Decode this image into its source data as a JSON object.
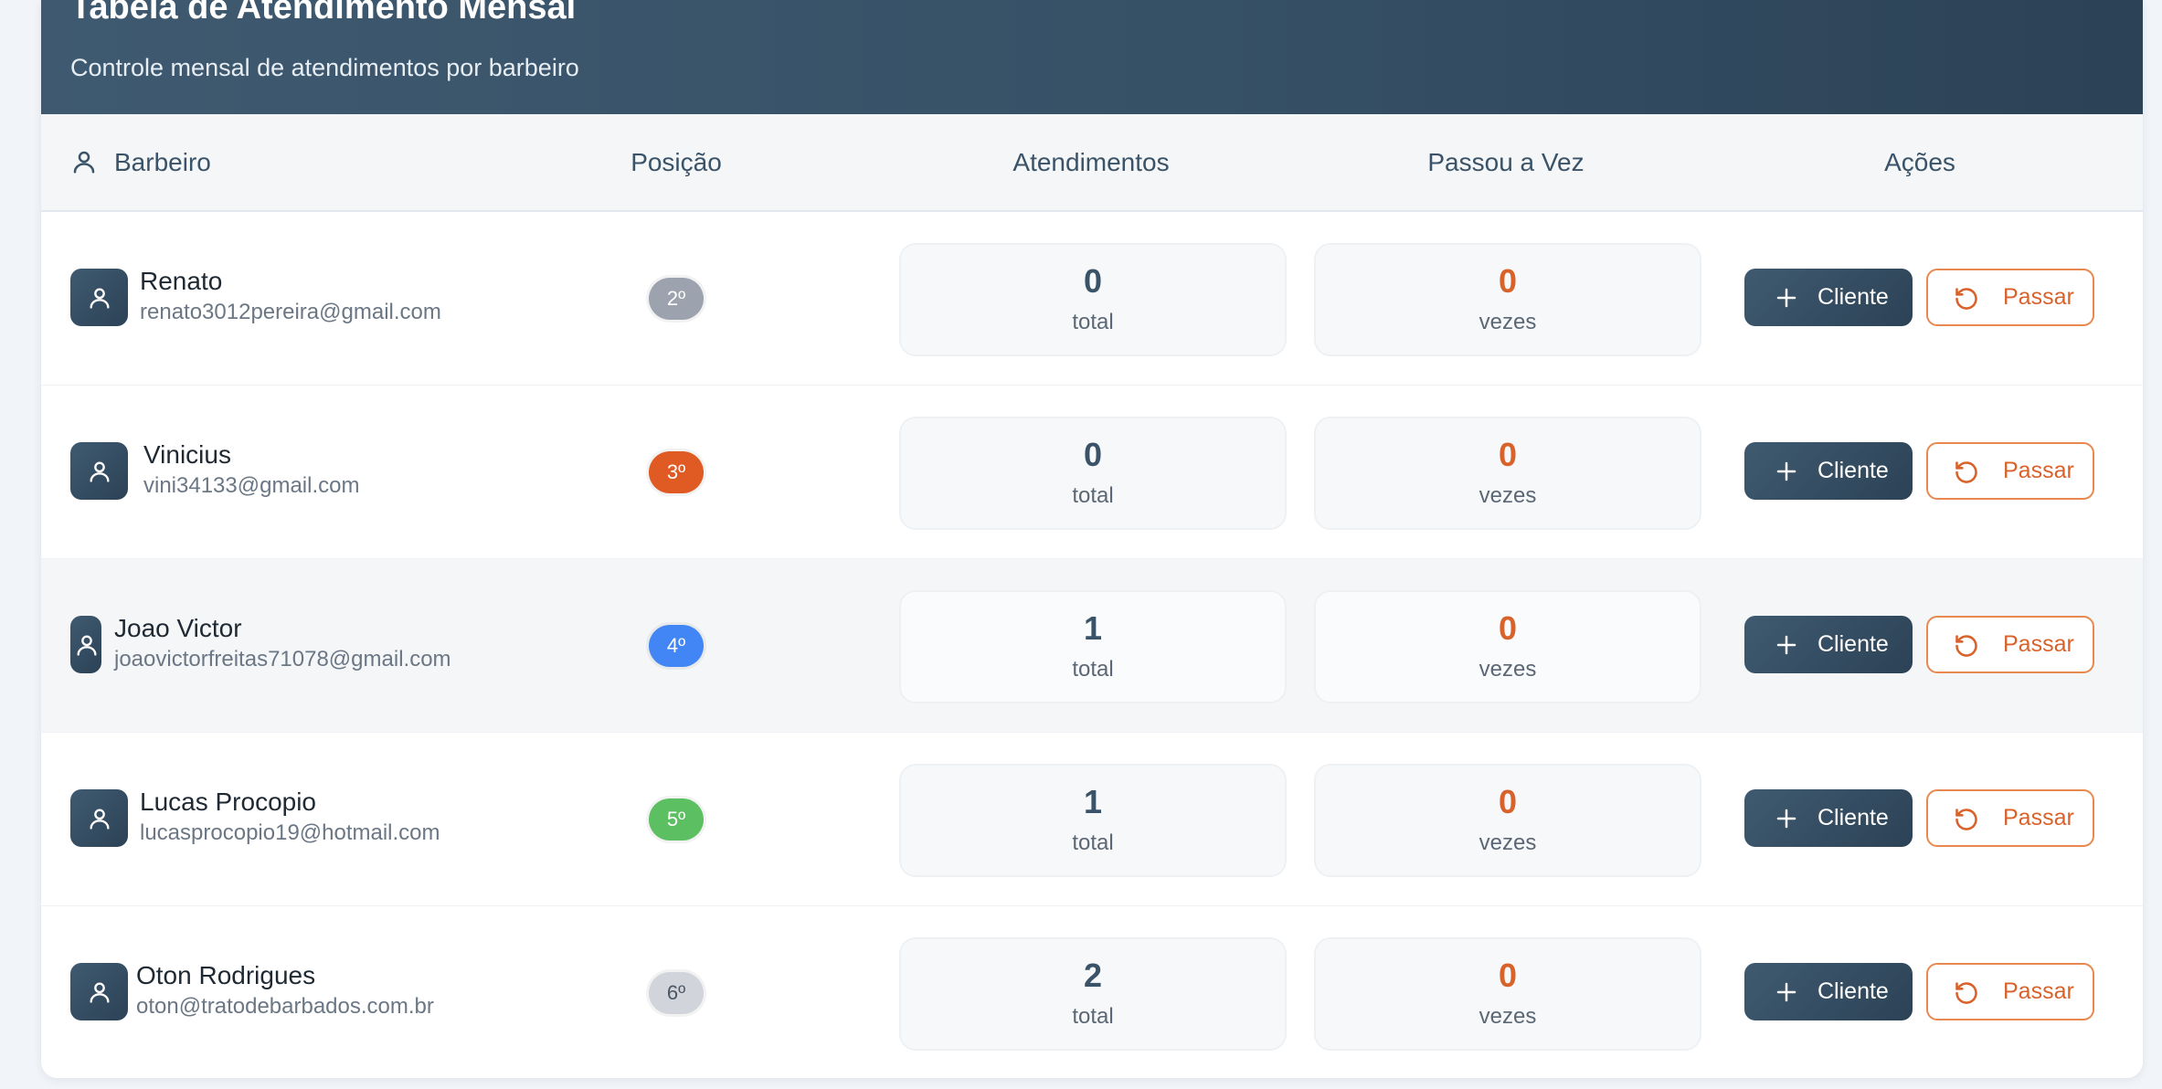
{
  "header": {
    "title": "Tabela de Atendimento Mensal",
    "subtitle": "Controle mensal de atendimentos por barbeiro"
  },
  "columns": {
    "barbeiro": "Barbeiro",
    "posicao": "Posição",
    "atendimentos": "Atendimentos",
    "passou": "Passou a Vez",
    "acoes": "Ações"
  },
  "buttons": {
    "cliente": "Cliente",
    "passar": "Passar"
  },
  "icons": {
    "header_barber": "user-icon",
    "avatar": "user-icon",
    "cliente": "plus-icon",
    "passar": "rotate-ccw-icon"
  },
  "colors": {
    "primary": "#365066",
    "accent_orange": "#d9622b",
    "pos_gray": "#9ca3af",
    "pos_orange": "#e05a24",
    "pos_blue": "#4285f4",
    "pos_green": "#5cbf61",
    "pos_light": "#d1d5db"
  },
  "rows": [
    {
      "name": "Renato",
      "email": "renato3012pereira@gmail.com",
      "position": "2º",
      "atendimentos": "0",
      "atendimentos_label": "total",
      "passou": "0",
      "passou_label": "vezes"
    },
    {
      "name": "Vinicius",
      "email": "vini34133@gmail.com",
      "position": "3º",
      "atendimentos": "0",
      "atendimentos_label": "total",
      "passou": "0",
      "passou_label": "vezes"
    },
    {
      "name": "Joao Victor",
      "email": "joaovictorfreitas71078@gmail.com",
      "position": "4º",
      "atendimentos": "1",
      "atendimentos_label": "total",
      "passou": "0",
      "passou_label": "vezes"
    },
    {
      "name": "Lucas Procopio",
      "email": "lucasprocopio19@hotmail.com",
      "position": "5º",
      "atendimentos": "1",
      "atendimentos_label": "total",
      "passou": "0",
      "passou_label": "vezes"
    },
    {
      "name": "Oton Rodrigues",
      "email": "oton@tratodebarbados.com.br",
      "position": "6º",
      "atendimentos": "2",
      "atendimentos_label": "total",
      "passou": "0",
      "passou_label": "vezes"
    }
  ]
}
